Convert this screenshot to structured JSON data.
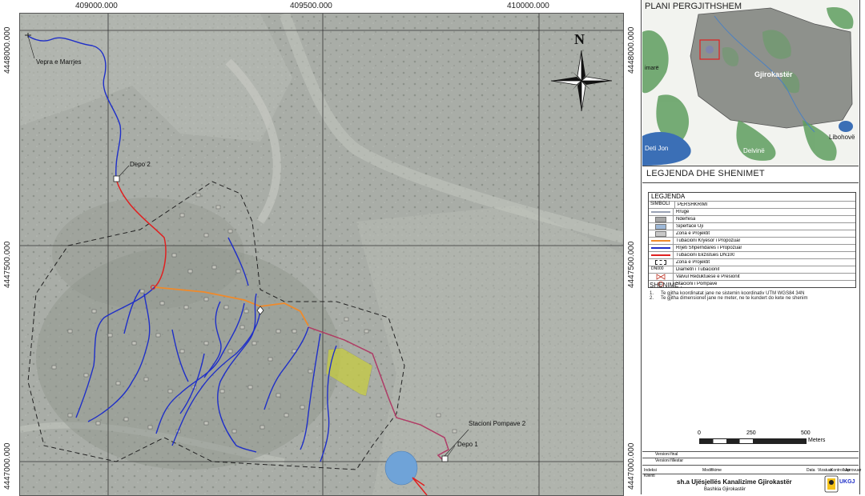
{
  "map": {
    "x_ticks": [
      "409000.000",
      "409500.000",
      "410000.000"
    ],
    "y_ticks": [
      "4448000.000",
      "4447500.000",
      "4447000.000"
    ],
    "north_label": "N",
    "labels": {
      "source": "Vepra e Marrjes",
      "depo2": "Depo 2",
      "pump2": "Stacioni Pompave 2",
      "depo1": "Depo 1"
    }
  },
  "inset": {
    "title": "PLANI PERGJITHSHEM",
    "places": {
      "city": "Gjirokastër",
      "sea": "Deti Jon",
      "delvine": "Delvinë",
      "libohove": "Libohovë",
      "left": "imarë"
    }
  },
  "legend": {
    "section_title": "LEGJENDA DHE SHENIMET",
    "table_title": "LEGJENDA",
    "col_symbol": "SIMBOLI",
    "col_desc": "PERSHKRIMI",
    "items": [
      {
        "desc": "Rruge",
        "color": "#9aa3b5",
        "kind": "line"
      },
      {
        "desc": "Nderfesa",
        "color": "#a6a6a6",
        "kind": "box"
      },
      {
        "desc": "Siperface Uji",
        "color": "#9db8d8",
        "kind": "box"
      },
      {
        "desc": "Zona e Projektit",
        "color": "#c8c8c8",
        "kind": "box"
      },
      {
        "desc": "Tubacioni Kryesor i Propozuar",
        "color": "#f08a2a",
        "kind": "line"
      },
      {
        "desc": "Rrjeti Shperndares i Propozuar",
        "color": "#1f2fc8",
        "kind": "line"
      },
      {
        "desc": "Tubacioni Ekzistues DN100",
        "color": "#e02020",
        "kind": "line"
      },
      {
        "desc": "Zona e Projektit",
        "color": "#222222",
        "kind": "dash"
      },
      {
        "desc": "Diametri i Tubacionit",
        "color": "#222222",
        "kind": "text",
        "sym": "DN000"
      },
      {
        "desc": "Valvul Reduktuese e Presionit",
        "color": "#c0392b",
        "kind": "valve"
      },
      {
        "desc": "Stacioni i Pompave",
        "color": "#c0392b",
        "kind": "circle"
      }
    ],
    "notes_title": "SHENIME :",
    "notes": [
      "Te gjitha koordinatat jane ne sistemin koordinativ UTM WGS84 34N",
      "Te gjitha dimensionet jane ne meter, ne te kundert do kete ne shenim"
    ],
    "notes_nums": [
      "1.",
      "2."
    ]
  },
  "scalebar": {
    "labels": [
      "0",
      "250",
      "500"
    ],
    "unit": "Meters"
  },
  "title_block": {
    "rev1": "Versioni final",
    "rev2": "Versioni fillestar",
    "col_modifikime": "Modifikime",
    "col_data": "Data",
    "col_vizatuar": "Vizatuar",
    "col_kontrolluar": "Kontrolluar",
    "col_aprovuar": "Aprovuar",
    "col_index": "Indeksi",
    "client_label": "Klienti",
    "client": "sh.a Ujësjellës Kanalizime Gjirokastër",
    "client_sub": "Bashkia Gjirokastër",
    "logo_text": "UKGJ"
  },
  "colors": {
    "main_pipe": "#f08a2a",
    "distribution": "#1f2fc8",
    "existing": "#e02020",
    "water": "#6fa3d8",
    "yellow_zone": "#c9cf3a"
  }
}
